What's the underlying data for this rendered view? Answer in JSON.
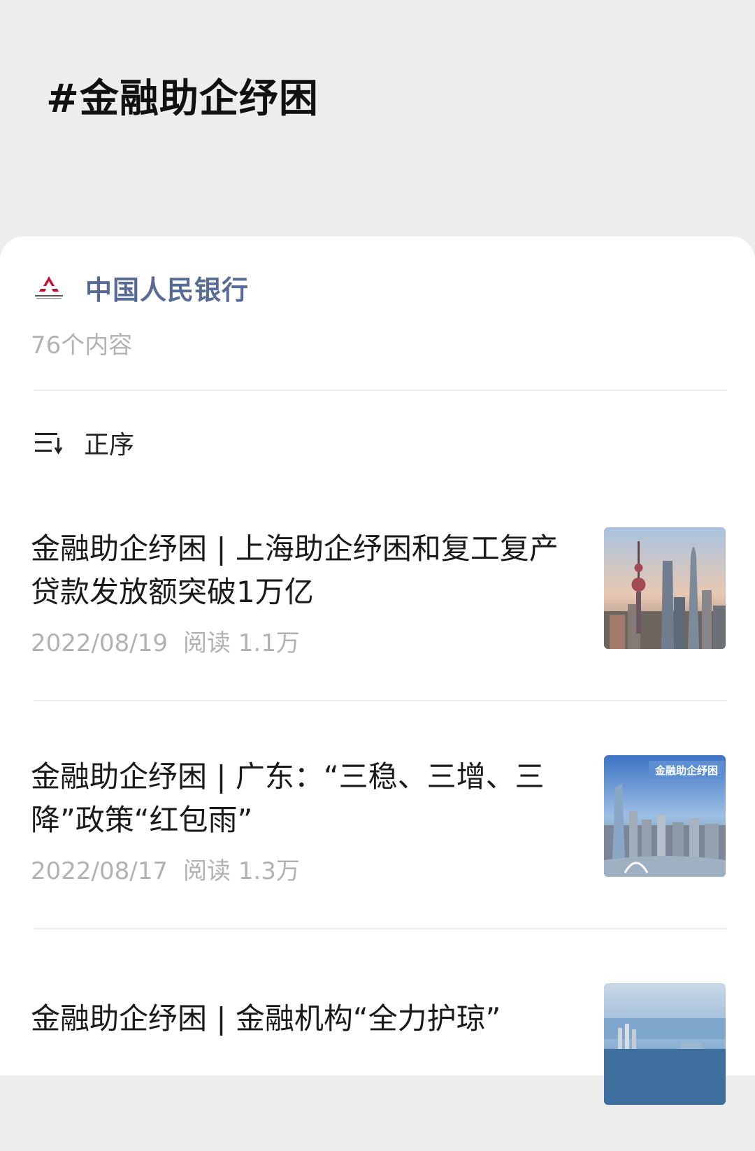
{
  "header": {
    "title": "#金融助企纾困"
  },
  "account": {
    "logo_icon": "pboc-logo-icon",
    "name": "中国人民银行",
    "content_count": "76个内容"
  },
  "sort": {
    "icon": "sort-order-icon",
    "label": "正序"
  },
  "articles": [
    {
      "title": "金融助企纾困 | 上海助企纾困和复工复产贷款发放额突破1万亿",
      "date": "2022/08/19",
      "reads": "阅读 1.1万",
      "thumb_icon": "shanghai-skyline-thumbnail"
    },
    {
      "title": "金融助企纾困 | 广东：“三稳、三增、三降”政策“红包雨”",
      "date": "2022/08/17",
      "reads": "阅读 1.3万",
      "thumb_icon": "guangzhou-skyline-thumbnail",
      "thumb_text": "金融助企纾困"
    },
    {
      "title": "金融助企纾困 | 金融机构“全力护琼”",
      "date": "",
      "reads": "",
      "thumb_icon": "hainan-coast-thumbnail"
    }
  ],
  "colors": {
    "account_name": "#576b95",
    "muted_text": "#b2b2b2",
    "header_bg": "#ededed"
  }
}
